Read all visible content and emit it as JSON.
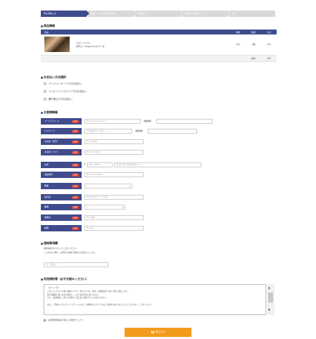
{
  "steps": [
    "申込情報入力",
    "確認メール(仮申込み受付)",
    "申込完了",
    "申込完了確認メール",
    "完了"
  ],
  "product_section": {
    "title": "商品情報",
    "headers": {
      "item": "商品",
      "price": "単価",
      "qty": "数量",
      "subtotal": "小計"
    },
    "item": {
      "code": "商品ID: XXX-001",
      "name": "専門コースSpecialメタデータ",
      "price": "1円",
      "qty": "1個",
      "subtotal": "1円"
    },
    "total": {
      "qty": "合計",
      "subtotal": "1円"
    }
  },
  "payment_section": {
    "title": "お支払い方法選択",
    "options": [
      "クレジットカードでのお支払い",
      "コンビニエンスストアでのお支払い",
      "銀行振込でのお支払い"
    ]
  },
  "customer_section": {
    "title": "お客様情報",
    "required_badge": "必須",
    "email": {
      "label": "メールアドレス",
      "placeholder": "例) mail@sample.com",
      "confirm_label": "(確認用)"
    },
    "password": {
      "label": "パスワード",
      "placeholder": "半角英数字8〜16文字",
      "confirm_label": "(確認用)"
    },
    "name": {
      "label": "お名前（漢字）",
      "placeholder": "例) 山田太郎"
    },
    "kana": {
      "label": "お名前（カナ）",
      "placeholder": "例) ヤマダタロウ"
    },
    "address": {
      "label": "住所",
      "zip_mark": "〒",
      "zip_placeholder": "例) 1234567",
      "addr_placeholder": "例) 東京都千代田区神田1-1-1"
    },
    "phone": {
      "label": "電話番号",
      "placeholder": "例) 09012345678"
    },
    "job": {
      "label": "職業",
      "value": "---"
    },
    "company": {
      "label": "会社名",
      "placeholder": "例) 株式会社サンプル商事"
    },
    "industry": {
      "label": "業種",
      "value": "---"
    },
    "dept": {
      "label": "部署名",
      "placeholder": "例) 営業部"
    },
    "position": {
      "label": "役職",
      "placeholder": "例) 課長"
    }
  },
  "remarks_section": {
    "title": "連絡事項欄",
    "note1": "連絡事項がありましたらご記入ください。",
    "note2": "ご入力がない場合、お問合せ内容を空欄のまま送信いたします。",
    "placeholder": "例) ご質問は"
  },
  "terms_section": {
    "title": "利用規約等（必ずお読みください）",
    "heading": "（ポリシー等）",
    "lines": [
      "入力していただいた個人情報について、申込クラスの、販売、商品発送のために当社に送信します。",
      "個人情報取り扱い担当の皆様し、このための目的に限りません。",
      "また、当該情報にご本人の同意なく第三者に提供することはありません。",
      "",
      "なお、ご登録いただいたメールアドレスには、今後弊社よりサービスのご案内をお送りすることがございます。ご了承ください。"
    ],
    "agree_label": "上記利用規約等に同意した場合チェック"
  },
  "submit_label": "申込する"
}
